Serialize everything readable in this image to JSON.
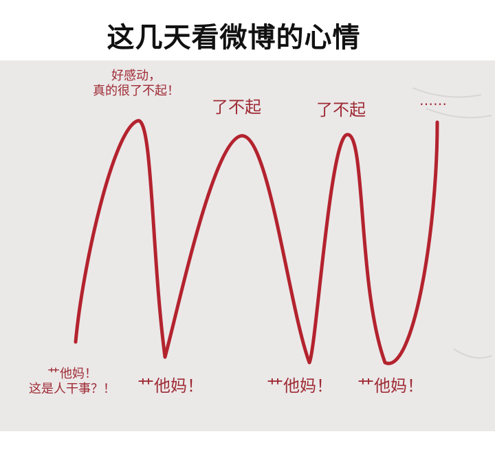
{
  "title": "这几天看微博的心情",
  "colors": {
    "curve": "#b3232e",
    "label": "#9e2a33",
    "card_background": "#ebe8e8"
  },
  "annotations": {
    "peak_1": "好感动，\n真的很了不起！",
    "peak_2": "了不起",
    "peak_3": "了不起",
    "peak_4": "……",
    "valley_1": "艹他妈！\n这是人干事？！",
    "valley_2": "艹他妈！",
    "valley_3": "艹他妈！",
    "valley_4": "艹他妈！"
  }
}
